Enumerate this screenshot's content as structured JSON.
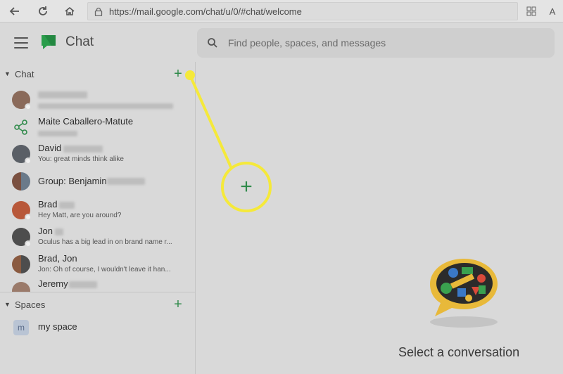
{
  "browser": {
    "url": "https://mail.google.com/chat/u/0/#chat/welcome",
    "reader_label": "A"
  },
  "header": {
    "app_title": "Chat",
    "search_placeholder": "Find people, spaces, and messages"
  },
  "sidebar": {
    "chat_section_label": "Chat",
    "spaces_section_label": "Spaces",
    "chats": [
      {
        "name": "",
        "preview": ""
      },
      {
        "name": "Maite Caballero-Matute",
        "preview": ""
      },
      {
        "name": "David",
        "preview": "You: great minds think alike"
      },
      {
        "name": "Group: Benjamin",
        "preview": ""
      },
      {
        "name": "Brad",
        "preview": "Hey Matt, are you around?"
      },
      {
        "name": "Jon",
        "preview": "Oculus has a big lead in on brand name r..."
      },
      {
        "name": "Brad, Jon",
        "preview": "Jon: Oh of course, I wouldn't leave it han..."
      },
      {
        "name": "Jeremy",
        "preview": ""
      }
    ],
    "spaces": [
      {
        "initial": "m",
        "name": "my space"
      }
    ]
  },
  "main": {
    "empty_state_text": "Select a conversation",
    "callout_plus": "+"
  },
  "colors": {
    "accent_green": "#2f8a4a",
    "callout_yellow": "#f5e93a"
  }
}
